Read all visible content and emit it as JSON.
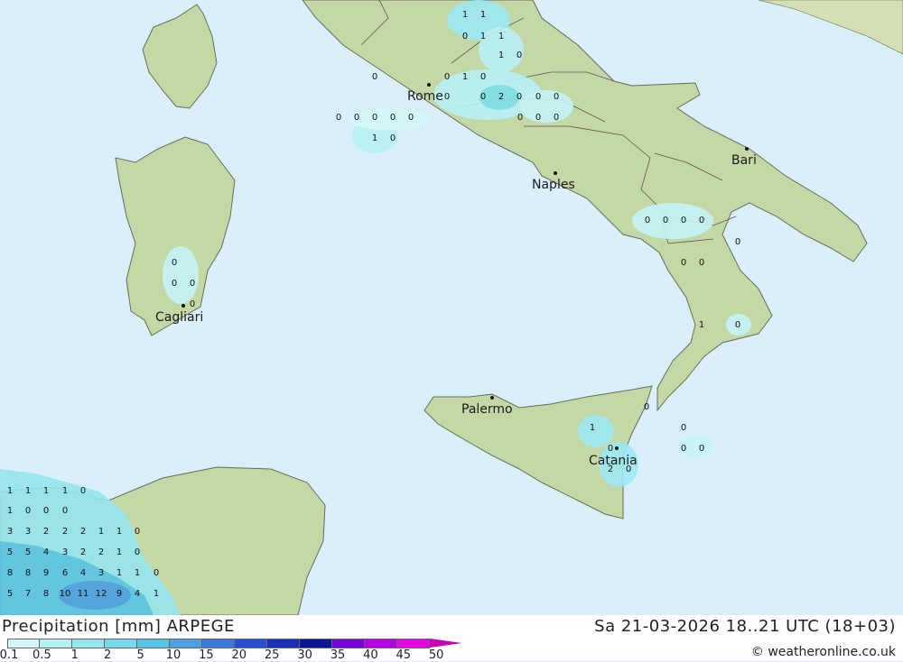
{
  "map": {
    "cities": [
      {
        "name": "Rome",
        "label": "Rome"
      },
      {
        "name": "Naples",
        "label": "Naples"
      },
      {
        "name": "Bari",
        "label": "Bari"
      },
      {
        "name": "Cagliari",
        "label": "Cagliari"
      },
      {
        "name": "Palermo",
        "label": "Palermo"
      },
      {
        "name": "Catania",
        "label": "Catania"
      }
    ],
    "values": [
      "1",
      "1",
      "0",
      "1",
      "1",
      "1",
      "0",
      "0",
      "0",
      "1",
      "0",
      "0",
      "2",
      "0",
      "0",
      "0",
      "0",
      "0",
      "0",
      "0",
      "0",
      "0",
      "0",
      "1",
      "0",
      "0",
      "0",
      "0",
      "0",
      "0",
      "0",
      "0",
      "0",
      "0",
      "0",
      "0",
      "0",
      "0",
      "1",
      "0",
      "0",
      "0",
      "0",
      "0",
      "0",
      "2",
      "0",
      "1",
      "1",
      "1",
      "1",
      "0",
      "1",
      "1",
      "0",
      "0",
      "0",
      "3",
      "3",
      "2",
      "2",
      "2",
      "1",
      "1",
      "0",
      "5",
      "5",
      "4",
      "3",
      "2",
      "2",
      "1",
      "0",
      "8",
      "8",
      "9",
      "6",
      "4",
      "3",
      "1",
      "1",
      "0",
      "5",
      "7",
      "8",
      "10",
      "11",
      "12",
      "9",
      "4",
      "1"
    ],
    "colors": {
      "sea": "#d9f0fa",
      "land": "#c8dcae",
      "rain_light": "#c4f4f8",
      "rain_mid": "#7ee0ec",
      "rain_heavy": "#5ab4e0"
    }
  },
  "footer": {
    "title": "Precipitation [mm] ARPEGE",
    "valid_time": "Sa 21-03-2026 18..21 UTC (18+03)",
    "credit": "© weatheronline.co.uk"
  },
  "legend": {
    "ticks": [
      "0.1",
      "0.5",
      "1",
      "2",
      "5",
      "10",
      "15",
      "20",
      "25",
      "30",
      "35",
      "40",
      "45",
      "50"
    ],
    "colors": [
      "#d2f6fa",
      "#b4f0f6",
      "#96e6f0",
      "#78d8ec",
      "#5ac4e6",
      "#4aa0e0",
      "#3a78dc",
      "#2850d0",
      "#1830b8",
      "#0a1496",
      "#7800dc",
      "#b400e6",
      "#e600e6",
      "#c800b4"
    ]
  }
}
